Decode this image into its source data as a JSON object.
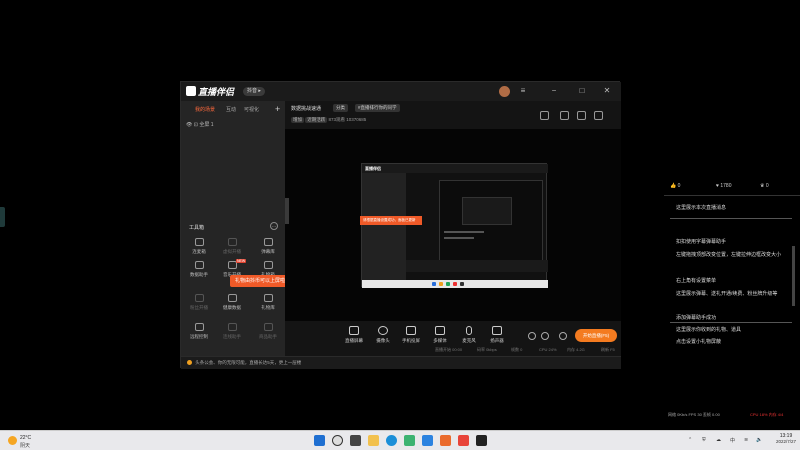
{
  "app": {
    "name": "直播伴侣",
    "version_badge": "抖音 ▸",
    "sidebar_tabs": [
      "我的场景",
      "互动",
      "可视化"
    ],
    "scene": "全屏 1",
    "tools_title": "工具箱",
    "tools": [
      {
        "label": "连麦箱",
        "dim": false
      },
      {
        "label": "虚拟开播",
        "dim": true
      },
      {
        "label": "弹幕库",
        "dim": false
      },
      {
        "label": "数据助手",
        "dim": false
      },
      {
        "label": "音乐开播",
        "dim": false,
        "hot": "NEW"
      },
      {
        "label": "礼物箱",
        "dim": false
      },
      {
        "label": "粉丝开播",
        "dim": true
      },
      {
        "label": "健康数据",
        "dim": false
      },
      {
        "label": "礼物库",
        "dim": false
      },
      {
        "label": "远程控制",
        "dim": false
      },
      {
        "label": "连线助手",
        "dim": true
      },
      {
        "label": "商品助手",
        "dim": true
      }
    ],
    "tooltip": "礼物由抖币可以上屏啦~",
    "tooltip_close": "✕",
    "bottom_notice": "头条公会、你的无限可能，直播长达5天，更上一层楼",
    "room_title": "数据挑战速通",
    "chips": [
      "分类",
      "#直播排行你的同学"
    ],
    "meta_tag": "增加",
    "meta_text": "近期活跃",
    "meta_stats": "873观看  10370685",
    "controls": [
      {
        "label": "直播屏幕"
      },
      {
        "label": "摄像头"
      },
      {
        "label": "手机投屏"
      },
      {
        "label": "多媒体"
      },
      {
        "label": "麦克风"
      },
      {
        "label": "扬声器"
      }
    ],
    "start_button": "开始直播(F5)",
    "status": [
      "直播开始 00:00",
      "码率 0kbps",
      "帧数 0",
      "CPU 24%",
      "内存 4.2G",
      "刷新 F5"
    ]
  },
  "nested": {
    "logo": "直播伴侣",
    "tip": "请根据直播设置成功，面板已更新"
  },
  "danmaku": {
    "stats": [
      "0",
      "1780",
      "0"
    ],
    "messages": [
      "这里展示本次直播消息",
      "扣扣使用字幕弹幕助手",
      "左键拖拽顶部改变位置，左键拉伸边框改变大小",
      "右上角有设置菜单",
      "这里展示弹幕、送礼开通/续费、粉丝牌升级等",
      "添加弹幕助手成功",
      "这里展示你收到的礼物、道具",
      "点击设置小礼物屏蔽"
    ],
    "footer_left": "网络 0Kb/s  FPS 30  丢帧 0.00",
    "footer_right": "CPU 18%  内存 4/4"
  },
  "taskbar": {
    "temp": "22°C",
    "weather": "阴天",
    "tray_lang": "中",
    "time": "13:19",
    "date": "2022/7/27"
  }
}
